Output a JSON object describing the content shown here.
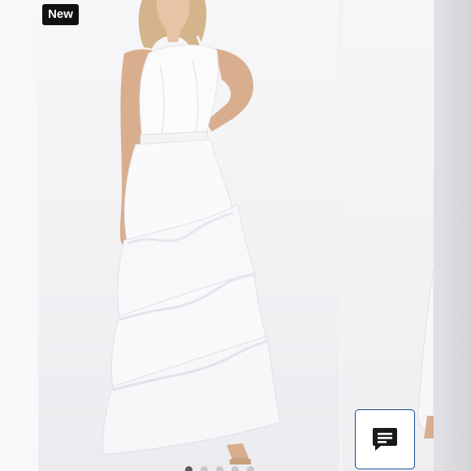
{
  "listing": {
    "badge_label": "New",
    "carousel": {
      "slide_count": 5,
      "active_index": 0
    }
  },
  "icons": {
    "chat": "chat-bubble-lines-icon"
  },
  "colors": {
    "badge_bg": "#111111",
    "badge_text": "#ffffff",
    "chat_border": "#1d4f91",
    "chat_icon": "#1a1a1a"
  }
}
